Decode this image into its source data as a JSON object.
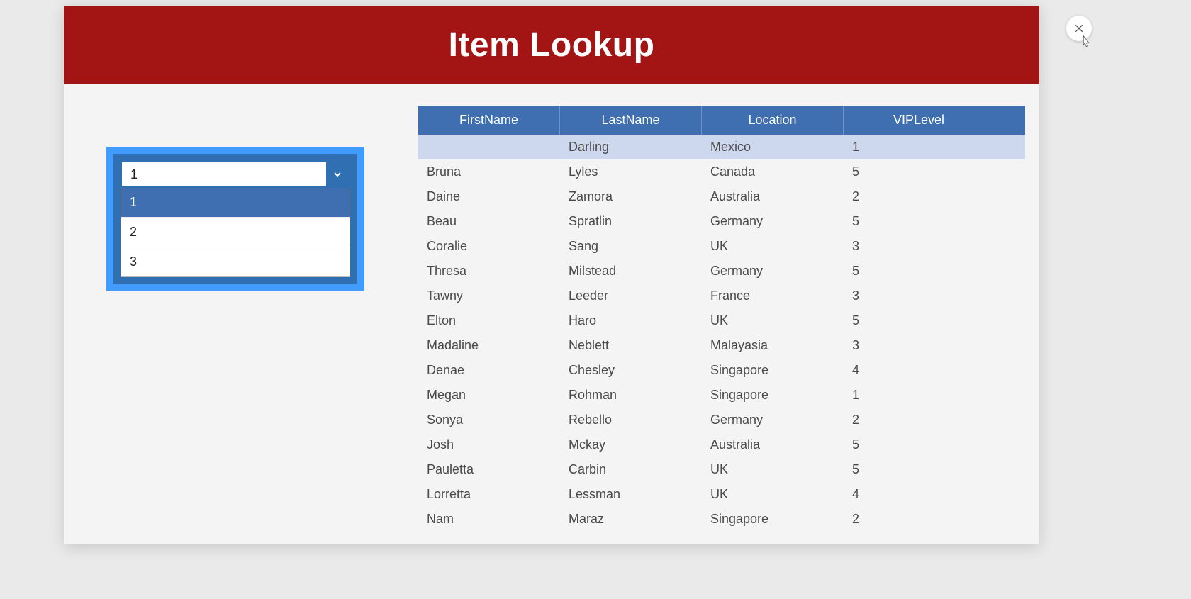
{
  "header": {
    "title": "Item Lookup"
  },
  "dropdown": {
    "value": "1",
    "options": [
      "1",
      "2",
      "3"
    ],
    "selectedIndex": 0
  },
  "table": {
    "headers": [
      "FirstName",
      "LastName",
      "Location",
      "VIPLevel"
    ],
    "rows": [
      {
        "first": "",
        "last": "Darling",
        "loc": "Mexico",
        "vip": "1",
        "hl": true
      },
      {
        "first": "Bruna",
        "last": "Lyles",
        "loc": "Canada",
        "vip": "5"
      },
      {
        "first": "Daine",
        "last": "Zamora",
        "loc": "Australia",
        "vip": "2"
      },
      {
        "first": "Beau",
        "last": "Spratlin",
        "loc": "Germany",
        "vip": "5"
      },
      {
        "first": "Coralie",
        "last": "Sang",
        "loc": "UK",
        "vip": "3"
      },
      {
        "first": "Thresa",
        "last": "Milstead",
        "loc": "Germany",
        "vip": "5"
      },
      {
        "first": "Tawny",
        "last": "Leeder",
        "loc": "France",
        "vip": "3"
      },
      {
        "first": "Elton",
        "last": "Haro",
        "loc": "UK",
        "vip": "5"
      },
      {
        "first": "Madaline",
        "last": "Neblett",
        "loc": "Malayasia",
        "vip": "3"
      },
      {
        "first": "Denae",
        "last": "Chesley",
        "loc": "Singapore",
        "vip": "4"
      },
      {
        "first": "Megan",
        "last": "Rohman",
        "loc": "Singapore",
        "vip": "1"
      },
      {
        "first": "Sonya",
        "last": "Rebello",
        "loc": "Germany",
        "vip": "2"
      },
      {
        "first": "Josh",
        "last": "Mckay",
        "loc": "Australia",
        "vip": "5"
      },
      {
        "first": "Pauletta",
        "last": "Carbin",
        "loc": "UK",
        "vip": "5"
      },
      {
        "first": "Lorretta",
        "last": "Lessman",
        "loc": "UK",
        "vip": "4"
      },
      {
        "first": "Nam",
        "last": "Maraz",
        "loc": "Singapore",
        "vip": "2"
      }
    ]
  }
}
